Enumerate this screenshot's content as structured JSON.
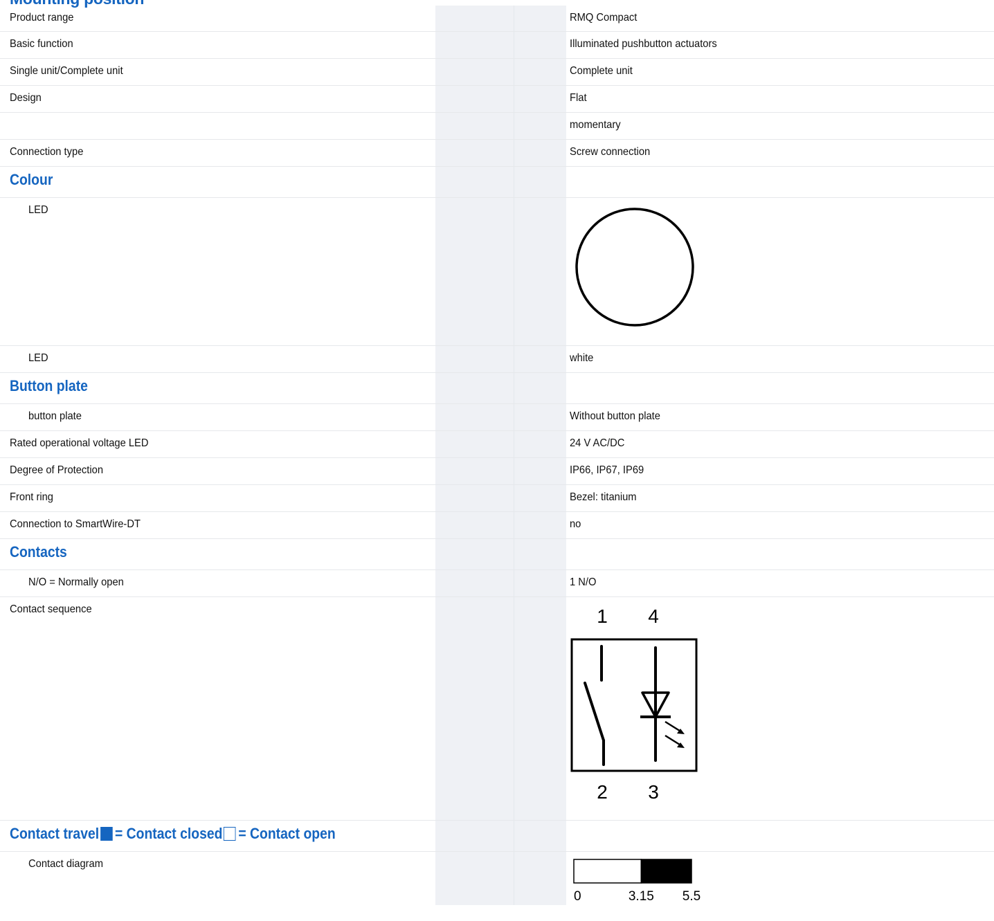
{
  "top_heading": "Mounting position",
  "rows": [
    {
      "label": "Product range",
      "value": "RMQ Compact"
    },
    {
      "label": "Basic function",
      "value": "Illuminated pushbutton actuators"
    },
    {
      "label": "Single unit/Complete unit",
      "value": "Complete unit"
    },
    {
      "label": "Design",
      "value": "Flat"
    },
    {
      "label": "",
      "value": "momentary"
    },
    {
      "label": "Connection type",
      "value": "Screw connection"
    }
  ],
  "colour": {
    "title": "Colour",
    "led_image_label": "LED",
    "led_label": "LED",
    "led_value": "white"
  },
  "button_plate": {
    "title": "Button plate",
    "label": "button plate",
    "value": "Without button plate"
  },
  "rows2": [
    {
      "label": "Rated operational voltage LED",
      "value": "24 V AC/DC"
    },
    {
      "label": "Degree of Protection",
      "value": "IP66, IP67, IP69"
    },
    {
      "label": "Front ring",
      "value": "Bezel: titanium"
    },
    {
      "label": "Connection to SmartWire-DT",
      "value": "no"
    }
  ],
  "contacts": {
    "title": "Contacts",
    "no_label": "N/O = Normally open",
    "no_value": "1 N/O",
    "sequence_label": "Contact sequence",
    "terminals": {
      "top_left": "1",
      "top_right": "4",
      "bottom_left": "2",
      "bottom_right": "3"
    }
  },
  "contact_travel": {
    "title": "Contact travel",
    "closed_legend": "= Contact closed",
    "open_legend": "= Contact open",
    "diagram_label": "Contact diagram",
    "ticks": [
      "0",
      "3.15",
      "5.5"
    ],
    "segments": [
      {
        "from": 0,
        "to": 3.15,
        "state": "open"
      },
      {
        "from": 3.15,
        "to": 5.5,
        "state": "closed"
      }
    ]
  },
  "colors": {
    "accent": "#1565c0",
    "grey_column": "#eff1f5"
  }
}
